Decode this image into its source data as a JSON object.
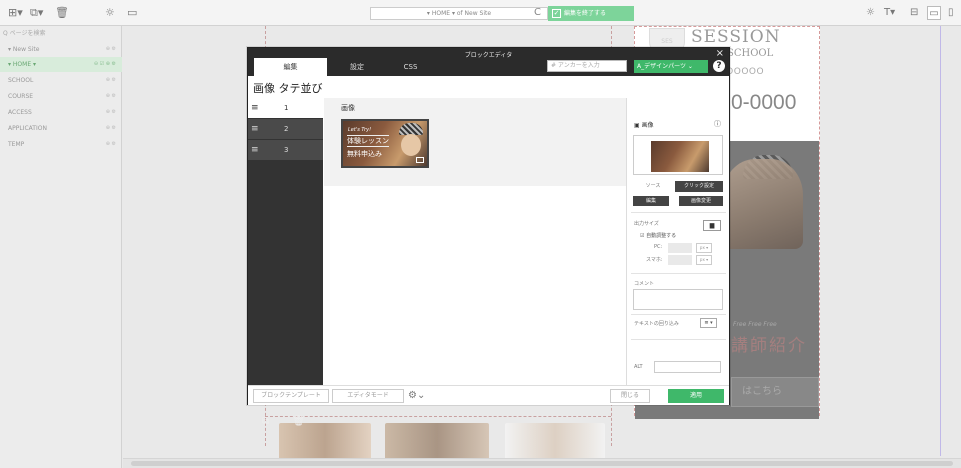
{
  "toolbar": {
    "address": "▾ HOME ▾ of New Site",
    "finish_button": "編集を終了する",
    "reload_glyph": "C",
    "icons_left": [
      "page-add-icon",
      "page-copy-icon",
      "trash-icon",
      "settings-icon",
      "layout-icon"
    ],
    "icons_right": [
      "gear-icon",
      "text-icon",
      "grid-icon",
      "desktop-icon"
    ]
  },
  "sidebar": {
    "search_placeholder": "Q ページを検索",
    "items": [
      {
        "label": "▾ New Site",
        "actions": "⊕ ⚙"
      },
      {
        "label": "▾ HOME ▾",
        "actions": "⊖ ☑ ⊕ ⚙"
      },
      {
        "label": "SCHOOL",
        "actions": "⊕ ⚙"
      },
      {
        "label": "COURSE",
        "actions": "⊕ ⚙"
      },
      {
        "label": "ACCESS",
        "actions": "⊕ ⚙"
      },
      {
        "label": "APPLICATION",
        "actions": "⊕ ⚙"
      },
      {
        "label": "TEMP",
        "actions": "⊕ ⚙"
      }
    ]
  },
  "page_bg": {
    "logo": "SESSION",
    "logo_sub": "USHSCHOOL",
    "emblem": "SES",
    "dots": "OOOOOOO",
    "phone": "0-0000",
    "free_text": "Free Free Free",
    "teacher_text": "講師紹介",
    "button_text": "はこちら"
  },
  "modal": {
    "title": "ブロックエディタ",
    "tabs": [
      "編集",
      "設定",
      "CSS"
    ],
    "anchor_placeholder": "# アンカーを入力",
    "guide_button": "A_デザインパーツ ⌄",
    "heading": "画像 タテ並び",
    "rows": [
      "1",
      "2",
      "3"
    ],
    "content": {
      "label": "画像",
      "thumb_line1": "Let's Try!",
      "thumb_line2": "体験レッスン",
      "thumb_line3": "無料申込み"
    },
    "props": {
      "title": "画像",
      "help": "ⓘ",
      "tab_source": "ソース",
      "tab_click": "クリック設定",
      "edit_button": "編集",
      "change_button": "画像変更",
      "output_size": "出力サイズ",
      "auto_adjust": "☑ 自動調整する",
      "pc_label": "PC:",
      "sp_label": "スマホ:",
      "unit": "px ▾",
      "comment": "コメント",
      "wrap": "テキストの回り込み",
      "wrap_select": "≣ ▾",
      "alt": "ALT"
    },
    "footer": {
      "template": "ブロックテンプレート",
      "editor_mode": "エディタモード",
      "close": "閉じる",
      "apply": "適用"
    }
  }
}
